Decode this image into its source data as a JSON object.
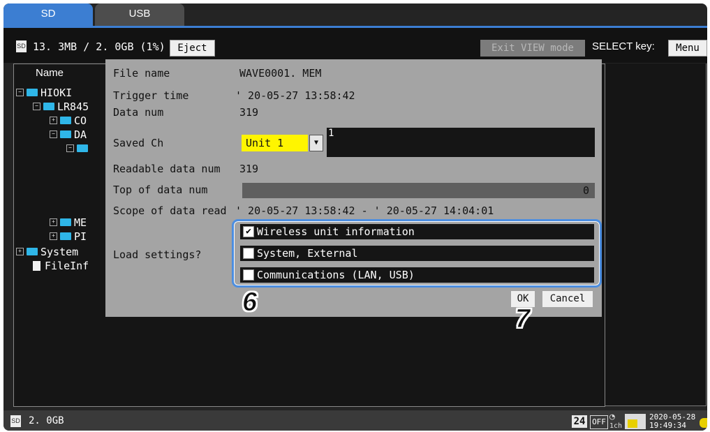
{
  "tabs": {
    "sd": "SD",
    "usb": "USB"
  },
  "storage": {
    "icon": "sd-card-icon",
    "usage": "13. 3MB / 2. 0GB (1%)",
    "eject_label": "Eject"
  },
  "toolbar": {
    "exit_view_label": "Exit VIEW mode",
    "select_key_label": "SELECT key:",
    "menu_label": "Menu"
  },
  "tree": {
    "header": "Name",
    "items": [
      "HIOKI",
      "LR845",
      "CO",
      "DA",
      "ME",
      "PI",
      "System",
      "FileInf"
    ]
  },
  "dialog": {
    "file_name_label": "File name",
    "file_name": "WAVE0001. MEM",
    "trigger_time_label": "Trigger time",
    "trigger_time": "' 20-05-27 13:58:42",
    "data_num_label": "Data num",
    "data_num": "319",
    "saved_ch_label": "Saved Ch",
    "saved_ch_value": "Unit 1",
    "saved_ch_box": "1",
    "readable_label": "Readable data num",
    "readable": "319",
    "top_label": "Top of data num",
    "top_value": "0",
    "scope_label": "Scope of data read",
    "scope": "' 20-05-27 13:58:42 - ' 20-05-27 14:04:01",
    "load_label": "Load settings?",
    "options": [
      {
        "label": "Wireless unit information",
        "checked": true
      },
      {
        "label": "System, External",
        "checked": false
      },
      {
        "label": "Communications (LAN, USB)",
        "checked": false
      }
    ],
    "ok_label": "OK",
    "cancel_label": "Cancel"
  },
  "callouts": {
    "step6": "6",
    "step7": "7"
  },
  "status": {
    "capacity": "2. 0GB",
    "channel_count": "24",
    "off_label": "OFF",
    "ch_label": "1ch",
    "date": "2020-05-28",
    "time": "19:49:34"
  },
  "colors": {
    "accent": "#3c7ed2",
    "highlight": "#fff500",
    "dialog_bg": "#a4a4a4",
    "screen_bg": "#242424"
  }
}
